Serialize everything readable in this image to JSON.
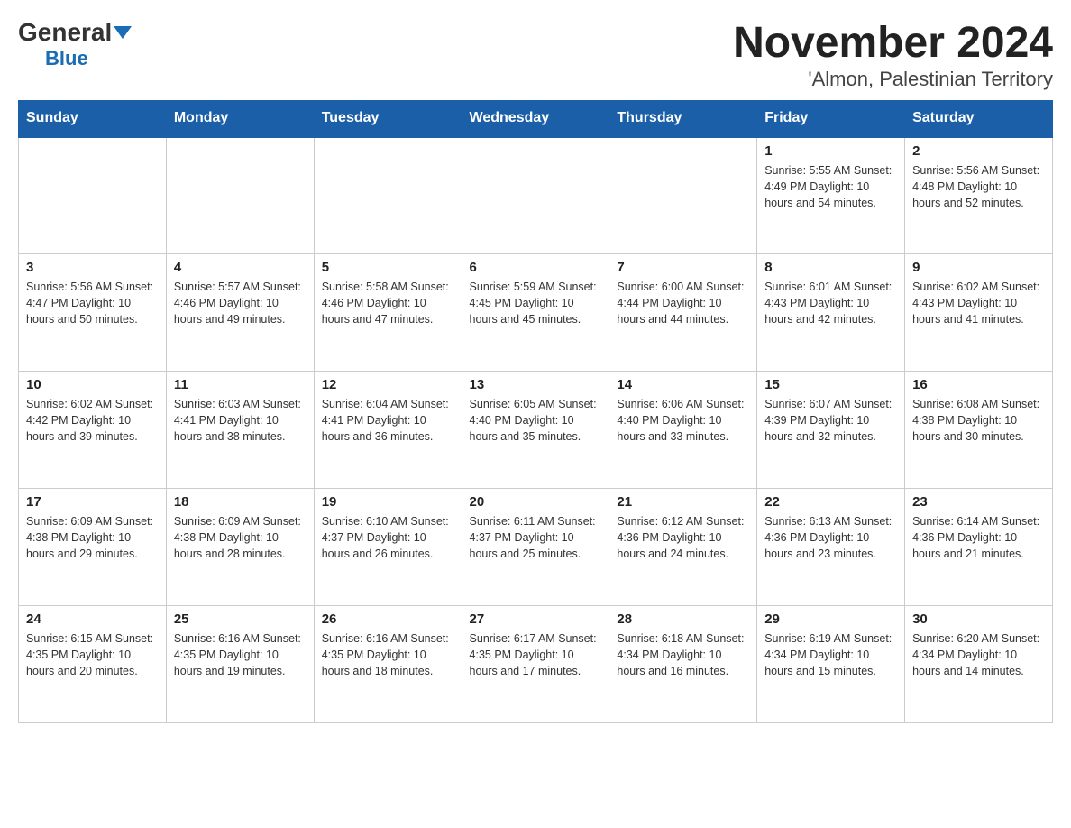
{
  "header": {
    "logo_general": "General",
    "logo_blue": "Blue",
    "title": "November 2024",
    "subtitle": "'Almon, Palestinian Territory"
  },
  "days_of_week": [
    "Sunday",
    "Monday",
    "Tuesday",
    "Wednesday",
    "Thursday",
    "Friday",
    "Saturday"
  ],
  "weeks": [
    [
      {
        "day": "",
        "info": ""
      },
      {
        "day": "",
        "info": ""
      },
      {
        "day": "",
        "info": ""
      },
      {
        "day": "",
        "info": ""
      },
      {
        "day": "",
        "info": ""
      },
      {
        "day": "1",
        "info": "Sunrise: 5:55 AM\nSunset: 4:49 PM\nDaylight: 10 hours and 54 minutes."
      },
      {
        "day": "2",
        "info": "Sunrise: 5:56 AM\nSunset: 4:48 PM\nDaylight: 10 hours and 52 minutes."
      }
    ],
    [
      {
        "day": "3",
        "info": "Sunrise: 5:56 AM\nSunset: 4:47 PM\nDaylight: 10 hours and 50 minutes."
      },
      {
        "day": "4",
        "info": "Sunrise: 5:57 AM\nSunset: 4:46 PM\nDaylight: 10 hours and 49 minutes."
      },
      {
        "day": "5",
        "info": "Sunrise: 5:58 AM\nSunset: 4:46 PM\nDaylight: 10 hours and 47 minutes."
      },
      {
        "day": "6",
        "info": "Sunrise: 5:59 AM\nSunset: 4:45 PM\nDaylight: 10 hours and 45 minutes."
      },
      {
        "day": "7",
        "info": "Sunrise: 6:00 AM\nSunset: 4:44 PM\nDaylight: 10 hours and 44 minutes."
      },
      {
        "day": "8",
        "info": "Sunrise: 6:01 AM\nSunset: 4:43 PM\nDaylight: 10 hours and 42 minutes."
      },
      {
        "day": "9",
        "info": "Sunrise: 6:02 AM\nSunset: 4:43 PM\nDaylight: 10 hours and 41 minutes."
      }
    ],
    [
      {
        "day": "10",
        "info": "Sunrise: 6:02 AM\nSunset: 4:42 PM\nDaylight: 10 hours and 39 minutes."
      },
      {
        "day": "11",
        "info": "Sunrise: 6:03 AM\nSunset: 4:41 PM\nDaylight: 10 hours and 38 minutes."
      },
      {
        "day": "12",
        "info": "Sunrise: 6:04 AM\nSunset: 4:41 PM\nDaylight: 10 hours and 36 minutes."
      },
      {
        "day": "13",
        "info": "Sunrise: 6:05 AM\nSunset: 4:40 PM\nDaylight: 10 hours and 35 minutes."
      },
      {
        "day": "14",
        "info": "Sunrise: 6:06 AM\nSunset: 4:40 PM\nDaylight: 10 hours and 33 minutes."
      },
      {
        "day": "15",
        "info": "Sunrise: 6:07 AM\nSunset: 4:39 PM\nDaylight: 10 hours and 32 minutes."
      },
      {
        "day": "16",
        "info": "Sunrise: 6:08 AM\nSunset: 4:38 PM\nDaylight: 10 hours and 30 minutes."
      }
    ],
    [
      {
        "day": "17",
        "info": "Sunrise: 6:09 AM\nSunset: 4:38 PM\nDaylight: 10 hours and 29 minutes."
      },
      {
        "day": "18",
        "info": "Sunrise: 6:09 AM\nSunset: 4:38 PM\nDaylight: 10 hours and 28 minutes."
      },
      {
        "day": "19",
        "info": "Sunrise: 6:10 AM\nSunset: 4:37 PM\nDaylight: 10 hours and 26 minutes."
      },
      {
        "day": "20",
        "info": "Sunrise: 6:11 AM\nSunset: 4:37 PM\nDaylight: 10 hours and 25 minutes."
      },
      {
        "day": "21",
        "info": "Sunrise: 6:12 AM\nSunset: 4:36 PM\nDaylight: 10 hours and 24 minutes."
      },
      {
        "day": "22",
        "info": "Sunrise: 6:13 AM\nSunset: 4:36 PM\nDaylight: 10 hours and 23 minutes."
      },
      {
        "day": "23",
        "info": "Sunrise: 6:14 AM\nSunset: 4:36 PM\nDaylight: 10 hours and 21 minutes."
      }
    ],
    [
      {
        "day": "24",
        "info": "Sunrise: 6:15 AM\nSunset: 4:35 PM\nDaylight: 10 hours and 20 minutes."
      },
      {
        "day": "25",
        "info": "Sunrise: 6:16 AM\nSunset: 4:35 PM\nDaylight: 10 hours and 19 minutes."
      },
      {
        "day": "26",
        "info": "Sunrise: 6:16 AM\nSunset: 4:35 PM\nDaylight: 10 hours and 18 minutes."
      },
      {
        "day": "27",
        "info": "Sunrise: 6:17 AM\nSunset: 4:35 PM\nDaylight: 10 hours and 17 minutes."
      },
      {
        "day": "28",
        "info": "Sunrise: 6:18 AM\nSunset: 4:34 PM\nDaylight: 10 hours and 16 minutes."
      },
      {
        "day": "29",
        "info": "Sunrise: 6:19 AM\nSunset: 4:34 PM\nDaylight: 10 hours and 15 minutes."
      },
      {
        "day": "30",
        "info": "Sunrise: 6:20 AM\nSunset: 4:34 PM\nDaylight: 10 hours and 14 minutes."
      }
    ]
  ]
}
